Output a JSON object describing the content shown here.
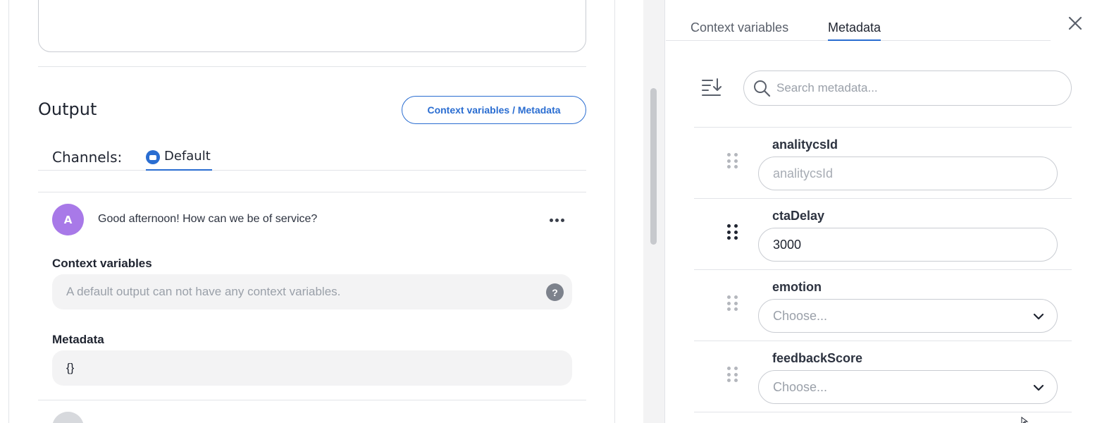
{
  "editor": {
    "output_title": "Output",
    "context_metadata_button": "Context variables / Metadata",
    "channels_label": "Channels:",
    "channel_tab": "Default",
    "message": {
      "avatar_initial": "A",
      "text": "Good afternoon! How can we be of service?"
    },
    "context_variables_label": "Context variables",
    "context_variables_placeholder": "A default output can not have any context variables.",
    "help_icon": "?",
    "metadata_label": "Metadata",
    "metadata_value": "{}"
  },
  "side_panel": {
    "tabs": [
      {
        "label": "Context variables",
        "active": false
      },
      {
        "label": "Metadata",
        "active": true
      }
    ],
    "search_placeholder": "Search metadata...",
    "fields": [
      {
        "key": "analitycsId",
        "type": "text",
        "value": "",
        "placeholder": "analitycsId"
      },
      {
        "key": "ctaDelay",
        "type": "text",
        "value": "3000",
        "placeholder": ""
      },
      {
        "key": "emotion",
        "type": "select",
        "value": "Choose..."
      },
      {
        "key": "feedbackScore",
        "type": "select",
        "value": "Choose..."
      }
    ]
  },
  "colors": {
    "accent": "#2a6dd1",
    "avatar": "#a879e8",
    "border": "#c9ccd2",
    "readonly_bg": "#f3f3f4"
  },
  "icons": [
    "chat-bubble-icon",
    "more-icon",
    "help-icon",
    "close-icon",
    "sort-icon",
    "search-icon",
    "drag-handle-icon",
    "chevron-down-icon"
  ]
}
